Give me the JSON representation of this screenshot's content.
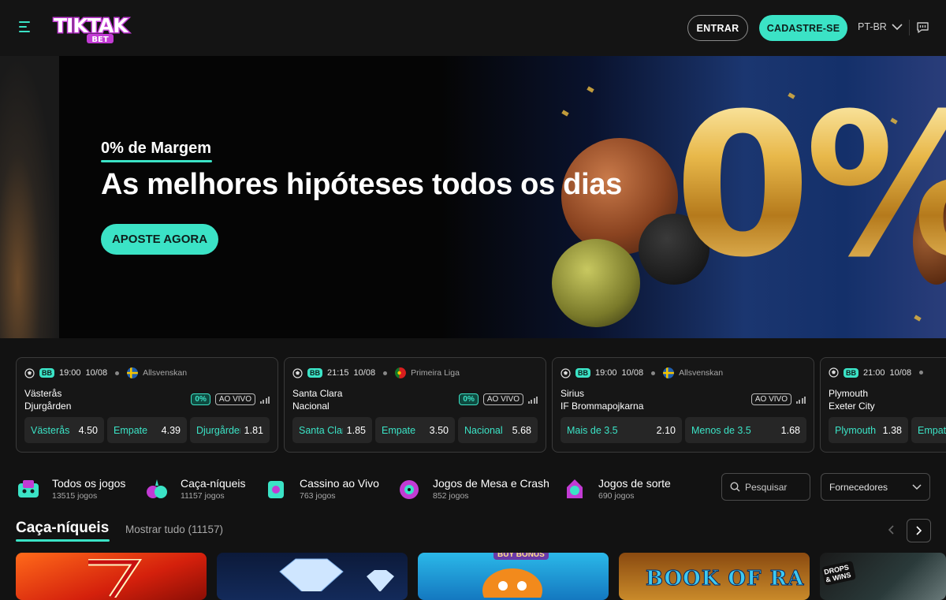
{
  "header": {
    "logo_text": "TIKTAK",
    "logo_sub": "BET",
    "login_label": "ENTRAR",
    "signup_label": "CADASTRE-SE",
    "language": "PT-BR",
    "menu_icon": "hamburger-menu-icon",
    "chat_icon": "chat-bubble-icon"
  },
  "hero": {
    "subtitle": "0% de Margem",
    "title": "As melhores hipóteses todos os dias",
    "cta_label": "APOSTE AGORA",
    "art_text": "0%"
  },
  "matches": [
    {
      "badge": "BB",
      "time": "19:00",
      "date": "10/08",
      "league": "Allsvenskan",
      "flag": "sweden",
      "home": "Västerås",
      "away": "Djurgården",
      "margin": "0%",
      "live": "AO VIVO",
      "odds": [
        {
          "label": "Västerås",
          "value": "4.50"
        },
        {
          "label": "Empate",
          "value": "4.39"
        },
        {
          "label": "Djurgården",
          "value": "1.81"
        }
      ]
    },
    {
      "badge": "BB",
      "time": "21:15",
      "date": "10/08",
      "league": "Primeira Liga",
      "flag": "portugal",
      "home": "Santa Clara",
      "away": "Nacional",
      "margin": "0%",
      "live": "AO VIVO",
      "odds": [
        {
          "label": "Santa Clara",
          "value": "1.85"
        },
        {
          "label": "Empate",
          "value": "3.50"
        },
        {
          "label": "Nacional",
          "value": "5.68"
        }
      ]
    },
    {
      "badge": "BB",
      "time": "19:00",
      "date": "10/08",
      "league": "Allsvenskan",
      "flag": "sweden",
      "home": "Sirius",
      "away": "IF Brommapojkarna",
      "margin": "",
      "live": "AO VIVO",
      "odds": [
        {
          "label": "Mais de 3.5",
          "value": "2.10"
        },
        {
          "label": "Menos de 3.5",
          "value": "1.68"
        }
      ]
    },
    {
      "badge": "BB",
      "time": "21:00",
      "date": "10/08",
      "league": "",
      "flag": "",
      "home": "Plymouth",
      "away": "Exeter City",
      "margin": "",
      "live": "",
      "odds": [
        {
          "label": "Plymouth",
          "value": "1.38"
        },
        {
          "label": "Empate",
          "value": ""
        }
      ]
    }
  ],
  "categories": [
    {
      "name": "Todos os jogos",
      "count": "13515 jogos",
      "icon": "all-games-icon"
    },
    {
      "name": "Caça-níqueis",
      "count": "11157 jogos",
      "icon": "slots-icon"
    },
    {
      "name": "Cassino ao Vivo",
      "count": "763 jogos",
      "icon": "live-casino-icon"
    },
    {
      "name": "Jogos de Mesa e Crash",
      "count": "852 jogos",
      "icon": "table-crash-icon"
    },
    {
      "name": "Jogos de sorte",
      "count": "690 jogos",
      "icon": "lucky-games-icon"
    }
  ],
  "search": {
    "placeholder": "Pesquisar"
  },
  "providers": {
    "label": "Fornecedores"
  },
  "section": {
    "title": "Caça-níqueis",
    "show_all": "Mostrar tudo (11157)"
  },
  "tiles": [
    {
      "label": ""
    },
    {
      "label": ""
    },
    {
      "label": "BUY BONUS"
    },
    {
      "label": "BOOK OF RA"
    },
    {
      "label": "DROPS & WINS"
    }
  ],
  "colors": {
    "accent": "#3be3c6",
    "background": "#121212",
    "card": "#161616"
  }
}
